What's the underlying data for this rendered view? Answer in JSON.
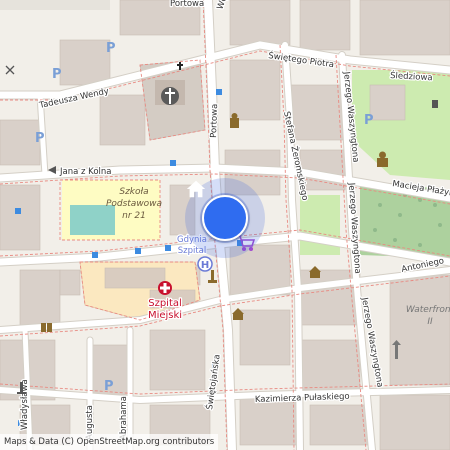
{
  "map": {
    "streets": {
      "swietego_piotra": "Świętego Piotra",
      "sledziowa": "Śledziowa",
      "tadeusza_wendy": "Tadeusza Wendy",
      "portowa": "Portowa",
      "stefana_zeromskiego": "Stefana Żeromskiego",
      "jerzego_waszyngtona_1": "Jerzego Waszyngtona",
      "jerzego_waszyngtona_2": "Jerzego Waszyngtona",
      "jerzego_waszyngtona_3": "Jerzego Waszyngtona",
      "jana_z_kolna": "Jana z Kolna",
      "macieja_plazynskiego": "Macieja Płażyńskiego",
      "antoniego": "Antoniego",
      "swietojanska": "Świętojańska",
      "abrahama": "Abrahama",
      "augusta": "Augusta",
      "wladyslawa": "Władysława",
      "kazimierza_pulaskiego": "Kazimierza Pułaskiego",
      "top_partial": "Portowa",
      "top_partial2": "Wę"
    },
    "places": {
      "school_line1": "Szkoła",
      "school_line2": "Podstawowa",
      "school_line3": "nr 21",
      "gdynia_szpital_line1": "Gdynia",
      "gdynia_szpital_line2": "Szpital",
      "hospital_line1": "Szpital",
      "hospital_line2": "Miejski",
      "waterfront_line1": "Waterfront",
      "waterfront_line2": "II"
    },
    "parking_glyph": "P",
    "hospital_glyph": "H",
    "location_marker": {
      "icon": "home-icon",
      "color": "#2f6cf0"
    },
    "attribution": "Maps & Data (C) OpenStreetMap.org contributors"
  }
}
